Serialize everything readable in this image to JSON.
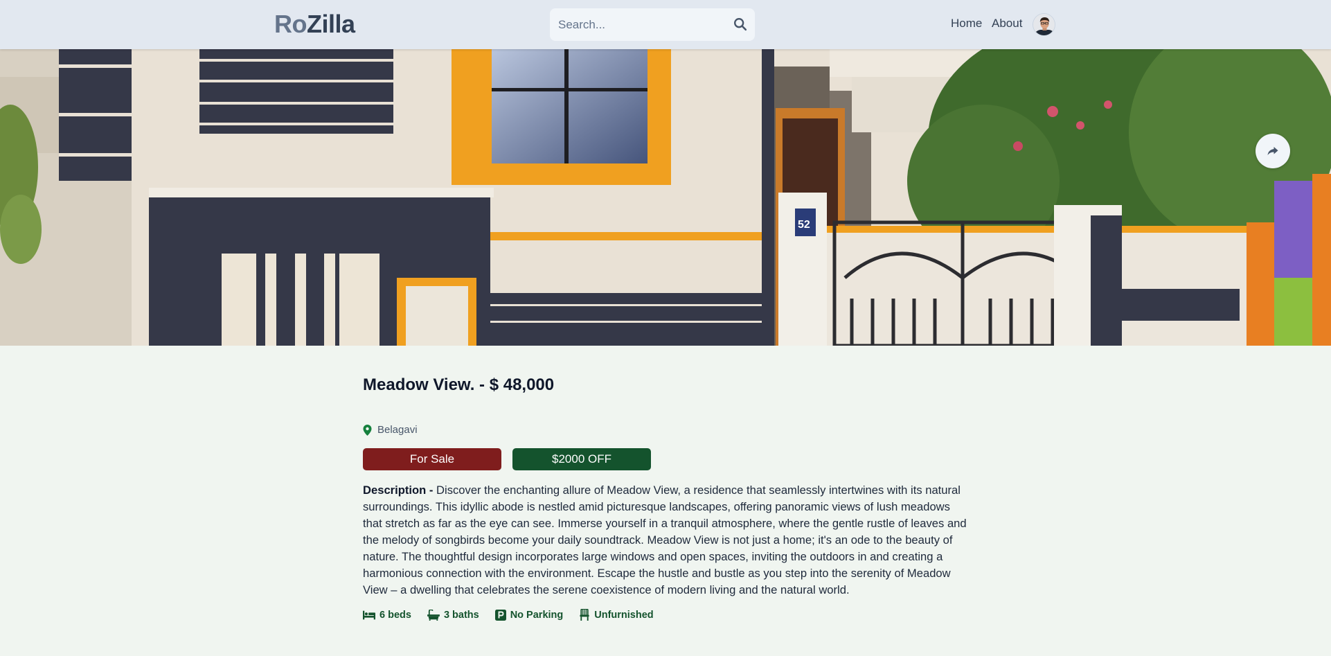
{
  "header": {
    "logo_part1": "Ro",
    "logo_part2": "Zilla",
    "search_placeholder": "Search...",
    "nav": {
      "home": "Home",
      "about": "About"
    }
  },
  "listing": {
    "title": "Meadow View. - $ 48,000",
    "location": "Belagavi",
    "type_badge": "For Sale",
    "discount_badge": "$2000 OFF",
    "description_label": "Description - ",
    "description": "Discover the enchanting allure of Meadow View, a residence that seamlessly intertwines with its natural surroundings. This idyllic abode is nestled amid picturesque landscapes, offering panoramic views of lush meadows that stretch as far as the eye can see. Immerse yourself in a tranquil atmosphere, where the gentle rustle of leaves and the melody of songbirds become your daily soundtrack. Meadow View is not just a home; it's an ode to the beauty of nature. The thoughtful design incorporates large windows and open spaces, inviting the outdoors in and creating a harmonious connection with the environment. Escape the hustle and bustle as you step into the serenity of Meadow View – a dwelling that celebrates the serene coexistence of modern living and the natural world.",
    "features": {
      "beds": "6 beds",
      "baths": "3 baths",
      "parking": "No Parking",
      "furnished": "Unfurnished"
    }
  },
  "hero_image": {
    "house_number": "52"
  },
  "colors": {
    "header_bg": "#e2e8f0",
    "page_bg": "#f0f5f0",
    "sale_badge": "#7f1d1d",
    "offer_badge": "#14532d",
    "feature_text": "#14532d"
  },
  "icons": {
    "search": "search-icon",
    "share": "share-icon",
    "location": "map-pin-icon",
    "beds": "bed-icon",
    "baths": "bath-icon",
    "parking": "parking-icon",
    "furnished": "chair-icon"
  }
}
